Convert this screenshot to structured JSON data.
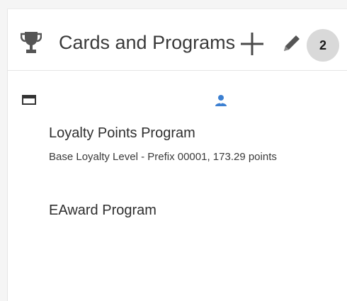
{
  "header": {
    "title": "Cards and Programs",
    "count": "2",
    "icons": {
      "trophy": "trophy-icon",
      "add": "plus-icon",
      "edit": "pencil-icon"
    }
  },
  "toolbar": {
    "card_icon": "card-icon",
    "member_icon": "member-icon"
  },
  "programs": [
    {
      "name": "Loyalty Points Program",
      "detail": "Base Loyalty Level - Prefix 00001, 173.29 points"
    },
    {
      "name": "EAward Program"
    }
  ],
  "colors": {
    "accent": "#3b7fd1",
    "icon_gray": "#555555",
    "badge_bg": "#d9d9d9"
  }
}
